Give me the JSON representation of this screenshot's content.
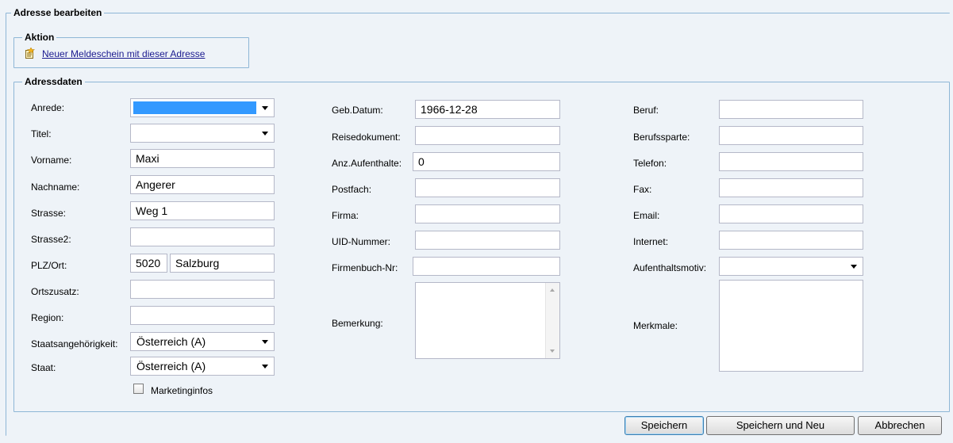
{
  "titles": {
    "main": "Adresse bearbeiten",
    "aktion": "Aktion",
    "adressdaten": "Adressdaten"
  },
  "aktion": {
    "link_label": "Neuer Meldeschein mit dieser Adresse",
    "icon": "new-document-icon"
  },
  "left": {
    "anrede_label": "Anrede:",
    "anrede_value": "",
    "titel_label": "Titel:",
    "titel_value": "",
    "vorname_label": "Vorname:",
    "vorname_value": "Maxi",
    "nachname_label": "Nachname:",
    "nachname_value": "Angerer",
    "strasse_label": "Strasse:",
    "strasse_value": "Weg 1",
    "strasse2_label": "Strasse2:",
    "strasse2_value": "",
    "plzort_label": "PLZ/Ort:",
    "plz_value": "5020",
    "ort_value": "Salzburg",
    "ortszusatz_label": "Ortszusatz:",
    "ortszusatz_value": "",
    "region_label": "Region:",
    "region_value": "",
    "staatsang_label": "Staatsangehörigkeit:",
    "staatsang_value": "Österreich (A)",
    "staat_label": "Staat:",
    "staat_value": "Österreich (A)",
    "marketing_label": "Marketinginfos",
    "marketing_checked": false
  },
  "middle": {
    "gebdatum_label": "Geb.Datum:",
    "gebdatum_value": "1966-12-28",
    "reisedok_label": "Reisedokument:",
    "reisedok_value": "",
    "aufenthalte_label": "Anz.Aufenthalte:",
    "aufenthalte_value": "0",
    "postfach_label": "Postfach:",
    "postfach_value": "",
    "firma_label": "Firma:",
    "firma_value": "",
    "uid_label": "UID-Nummer:",
    "uid_value": "",
    "firmenbuch_label": "Firmenbuch-Nr:",
    "firmenbuch_value": "",
    "bemerkung_label": "Bemerkung:",
    "bemerkung_value": ""
  },
  "right": {
    "beruf_label": "Beruf:",
    "beruf_value": "",
    "berufssparte_label": "Berufssparte:",
    "berufssparte_value": "",
    "telefon_label": "Telefon:",
    "telefon_value": "",
    "fax_label": "Fax:",
    "fax_value": "",
    "email_label": "Email:",
    "email_value": "",
    "internet_label": "Internet:",
    "internet_value": "",
    "motiv_label": "Aufenthaltsmotiv:",
    "motiv_value": "",
    "merkmale_label": "Merkmale:",
    "merkmale_value": ""
  },
  "buttons": {
    "save": "Speichern",
    "save_new": "Speichern und Neu",
    "cancel": "Abbrechen"
  },
  "colors": {
    "background": "#eef3f8",
    "fieldset_border": "#8eb6d6",
    "selection_highlight": "#3399ff",
    "link": "#1a1a8f"
  }
}
